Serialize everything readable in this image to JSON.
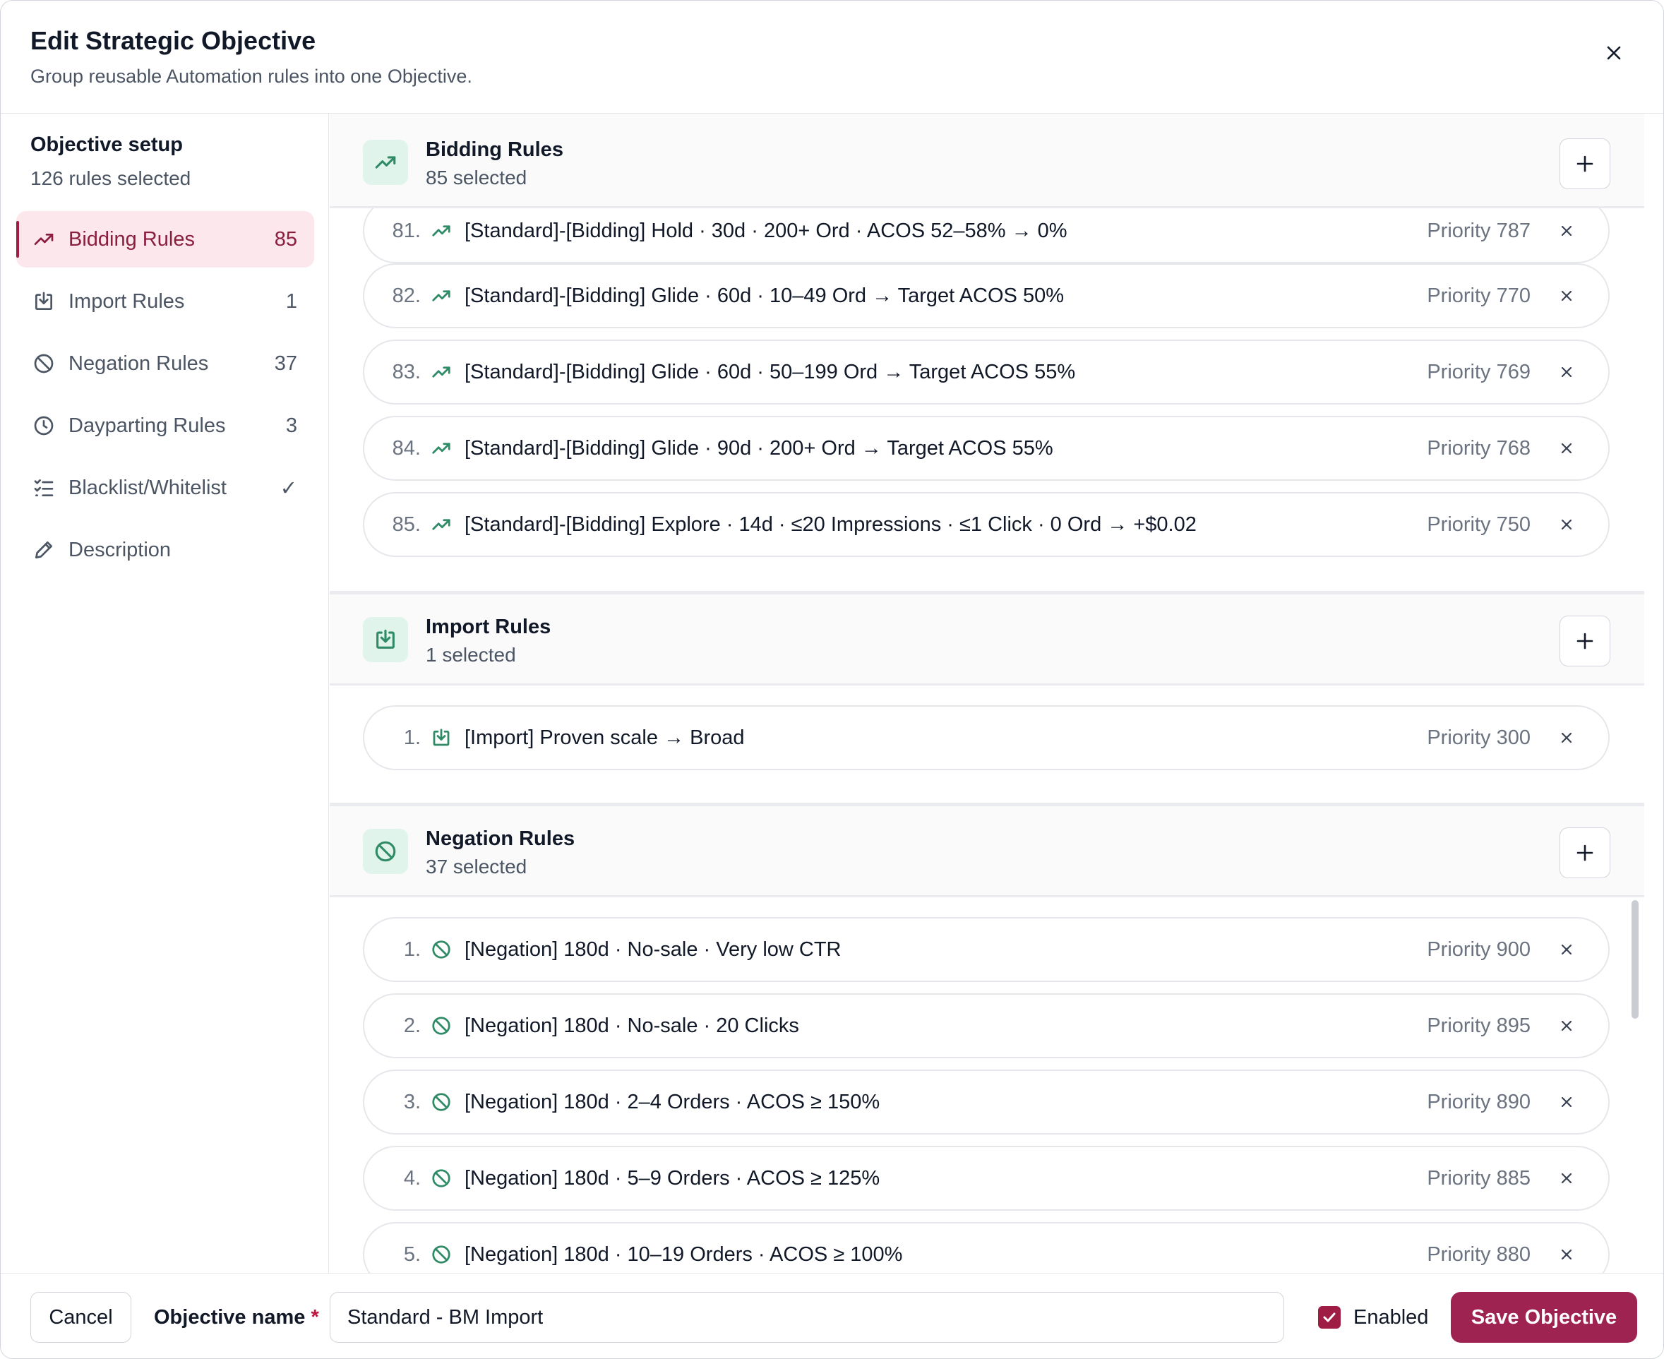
{
  "header": {
    "title": "Edit Strategic Objective",
    "subtitle": "Group reusable Automation rules into one Objective."
  },
  "sidebar": {
    "heading": "Objective setup",
    "count_text": "126 rules selected",
    "items": [
      {
        "label": "Bidding Rules",
        "badge": "85",
        "icon": "trending-up-icon",
        "active": true
      },
      {
        "label": "Import Rules",
        "badge": "1",
        "icon": "import-icon"
      },
      {
        "label": "Negation Rules",
        "badge": "37",
        "icon": "ban-icon"
      },
      {
        "label": "Dayparting Rules",
        "badge": "3",
        "icon": "clock-icon"
      },
      {
        "label": "Blacklist/Whitelist",
        "badge": "✓",
        "icon": "list-checks-icon"
      },
      {
        "label": "Description",
        "badge": "",
        "icon": "pencil-icon"
      }
    ]
  },
  "sections": {
    "bidding": {
      "title": "Bidding Rules",
      "subtitle": "85 selected",
      "rules": [
        {
          "num": "81.",
          "label": "[Standard]-[Bidding] Hold · 30d · 200+ Ord · ACOS 52–58% → 0%",
          "priority": "Priority 787"
        },
        {
          "num": "82.",
          "label": "[Standard]-[Bidding] Glide · 60d · 10–49 Ord → Target ACOS 50%",
          "priority": "Priority 770"
        },
        {
          "num": "83.",
          "label": "[Standard]-[Bidding] Glide · 60d · 50–199 Ord → Target ACOS 55%",
          "priority": "Priority 769"
        },
        {
          "num": "84.",
          "label": "[Standard]-[Bidding] Glide · 90d · 200+ Ord → Target ACOS 55%",
          "priority": "Priority 768"
        },
        {
          "num": "85.",
          "label": "[Standard]-[Bidding] Explore · 14d · ≤20 Impressions · ≤1 Click · 0 Ord → +$0.02",
          "priority": "Priority 750"
        }
      ]
    },
    "import": {
      "title": "Import Rules",
      "subtitle": "1 selected",
      "rules": [
        {
          "num": "1.",
          "label": "[Import] Proven scale → Broad",
          "priority": "Priority 300"
        }
      ]
    },
    "negation": {
      "title": "Negation Rules",
      "subtitle": "37 selected",
      "rules": [
        {
          "num": "1.",
          "label": "[Negation] 180d · No-sale · Very low CTR",
          "priority": "Priority 900"
        },
        {
          "num": "2.",
          "label": "[Negation] 180d · No-sale · 20 Clicks",
          "priority": "Priority 895"
        },
        {
          "num": "3.",
          "label": "[Negation] 180d · 2–4 Orders · ACOS ≥ 150%",
          "priority": "Priority 890"
        },
        {
          "num": "4.",
          "label": "[Negation] 180d · 5–9 Orders · ACOS ≥ 125%",
          "priority": "Priority 885"
        },
        {
          "num": "5.",
          "label": "[Negation] 180d · 10–19 Orders · ACOS ≥ 100%",
          "priority": "Priority 880"
        }
      ]
    }
  },
  "footer": {
    "cancel_label": "Cancel",
    "name_label": "Objective name",
    "required_mark": "*",
    "name_value": "Standard - BM Import",
    "enabled_label": "Enabled",
    "enabled": true,
    "save_label": "Save Objective"
  },
  "colors": {
    "accent": "#9f2350",
    "active_bg": "#fbe7ec",
    "icon_green": "#2f8a66",
    "icon_bg": "#e1f4ec"
  }
}
